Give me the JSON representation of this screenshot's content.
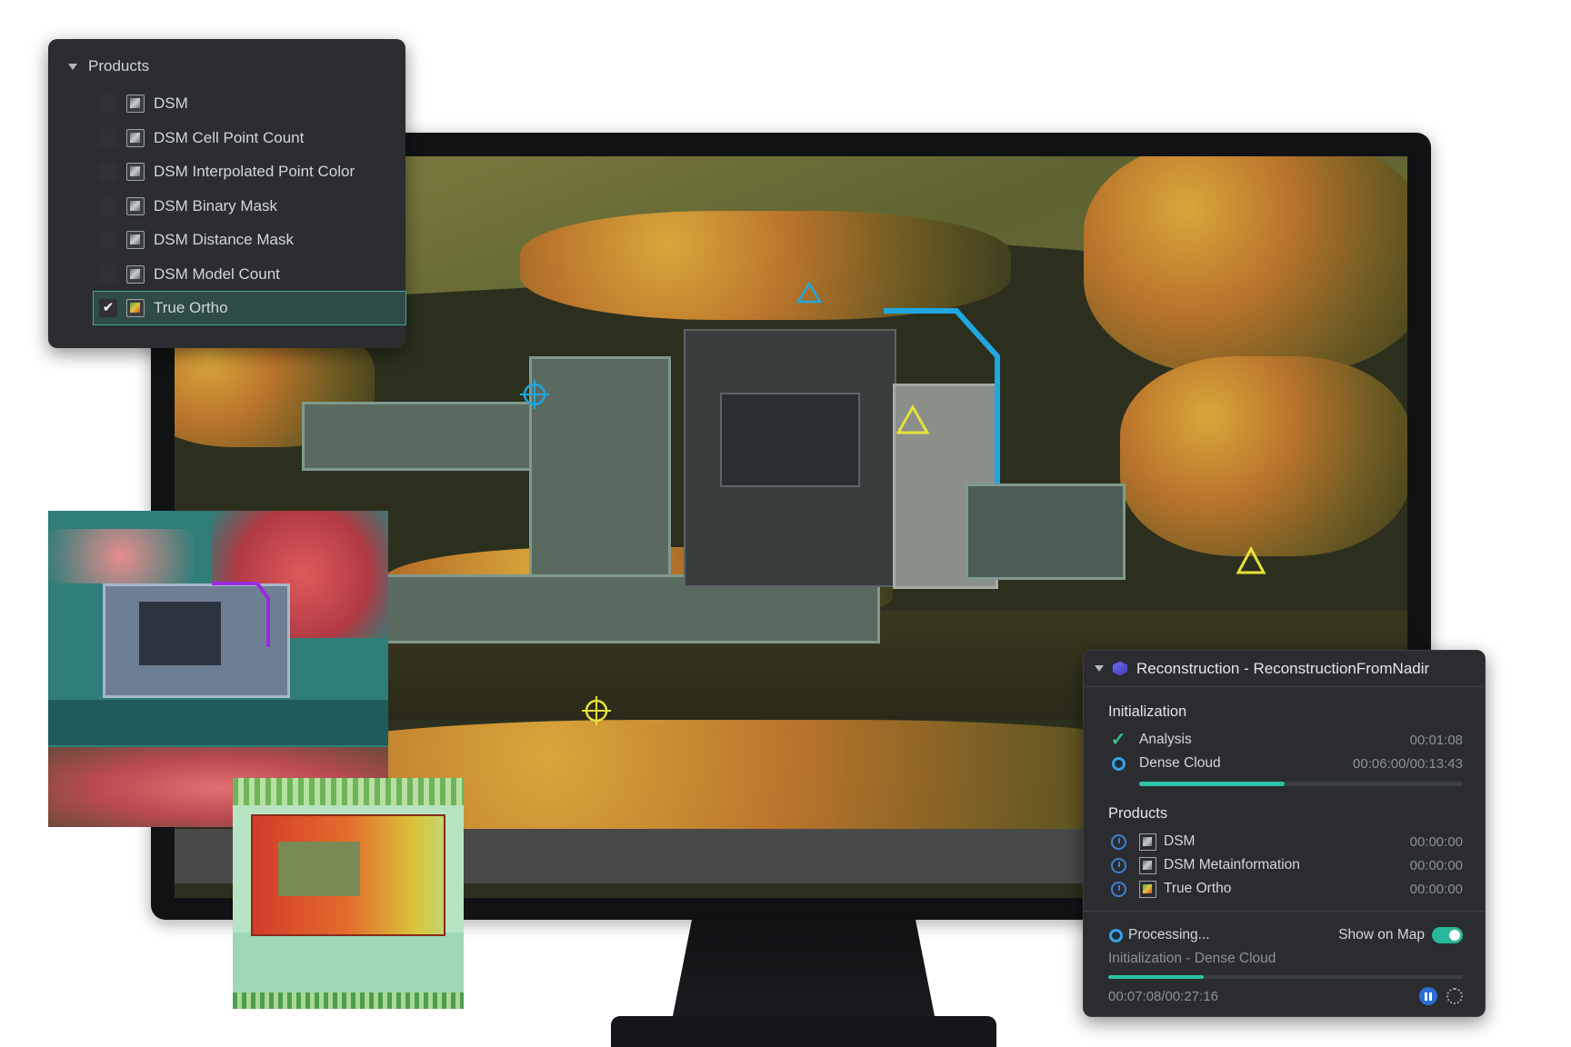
{
  "products_panel": {
    "header": "Products",
    "items": [
      {
        "label": "DSM",
        "checked": false
      },
      {
        "label": "DSM Cell Point Count",
        "checked": false
      },
      {
        "label": "DSM Interpolated Point Color",
        "checked": false
      },
      {
        "label": "DSM Binary Mask",
        "checked": false
      },
      {
        "label": "DSM Distance Mask",
        "checked": false
      },
      {
        "label": "DSM Model Count",
        "checked": false
      },
      {
        "label": "True Ortho",
        "checked": true
      }
    ],
    "check_glyph": "✔"
  },
  "reconstruction": {
    "title": "Reconstruction - ReconstructionFromNadir",
    "initialization": {
      "title": "Initialization",
      "steps": [
        {
          "label": "Analysis",
          "time": "00:01:08",
          "status": "done"
        },
        {
          "label": "Dense Cloud",
          "time": "00:06:00/00:13:43",
          "status": "running",
          "progress": 0.45
        }
      ]
    },
    "products": {
      "title": "Products",
      "items": [
        {
          "label": "DSM",
          "time": "00:00:00",
          "icon": "dsm-icon"
        },
        {
          "label": "DSM Metainformation",
          "time": "00:00:00",
          "icon": "metainformation-icon"
        },
        {
          "label": "True Ortho",
          "time": "00:00:00",
          "icon": "true-ortho-icon"
        }
      ]
    },
    "footer": {
      "status": "Processing...",
      "show_on_map_label": "Show on Map",
      "show_on_map": true,
      "stage": "Initialization - Dense Cloud",
      "elapsed": "00:07:08/00:27:16",
      "progress": 0.27
    }
  },
  "colors": {
    "accent": "#2ec4a8",
    "selection": "#2e4b48",
    "panel_bg": "#2b2d30"
  }
}
